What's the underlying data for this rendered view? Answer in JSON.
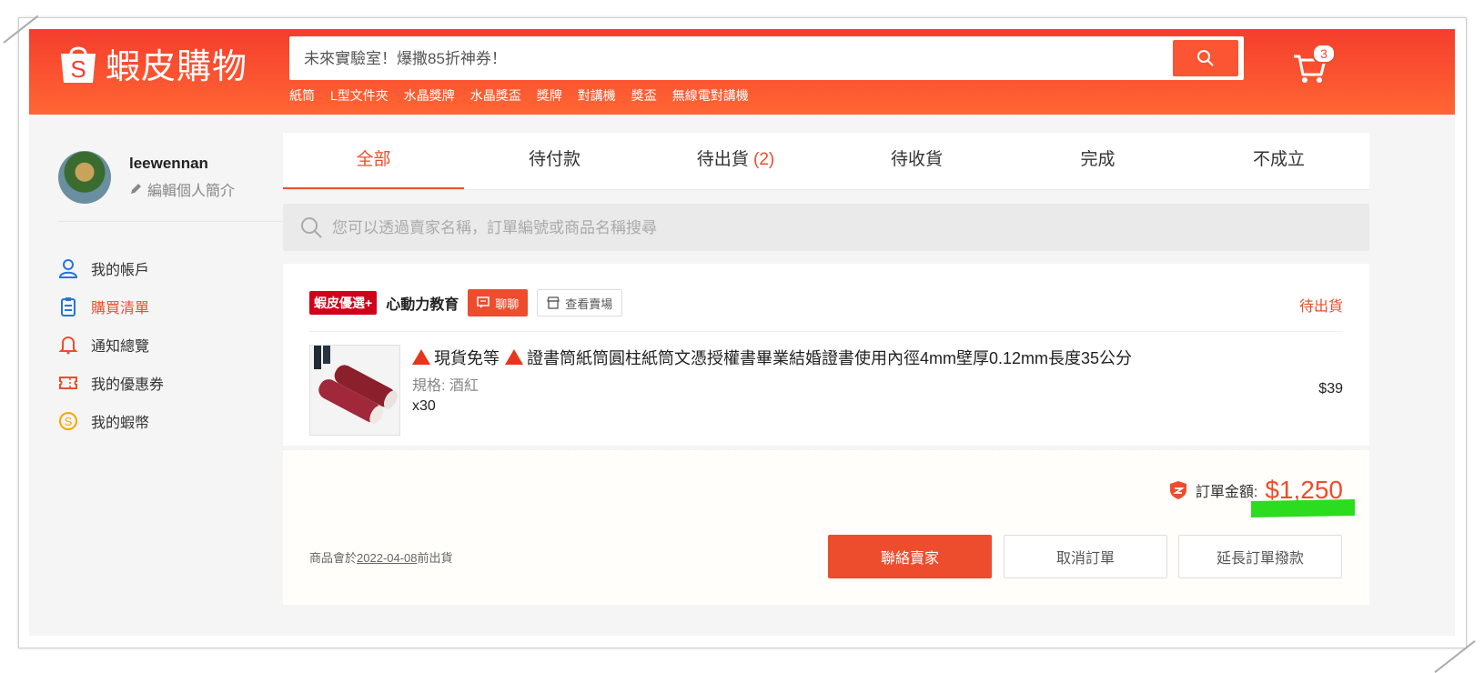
{
  "header": {
    "brand": "蝦皮購物",
    "search_placeholder": "未來實驗室！爆撒85折神券！",
    "hot_words": [
      "紙筒",
      "L型文件夾",
      "水晶獎牌",
      "水晶獎盃",
      "獎牌",
      "對講機",
      "獎盃",
      "無線電對講機"
    ],
    "cart_count": "3",
    "colors": {
      "brand": "#ee4d2d"
    }
  },
  "sidebar": {
    "username": "leewennan",
    "edit_profile": "編輯個人簡介",
    "menu": [
      {
        "label": "我的帳戶",
        "icon": "user-icon",
        "active": false
      },
      {
        "label": "購買清單",
        "icon": "clipboard-icon",
        "active": true
      },
      {
        "label": "通知總覽",
        "icon": "bell-icon",
        "active": false
      },
      {
        "label": "我的優惠券",
        "icon": "ticket-icon",
        "active": false
      },
      {
        "label": "我的蝦幣",
        "icon": "coin-icon",
        "active": false
      }
    ]
  },
  "tabs": [
    {
      "label": "全部",
      "count": "",
      "active": true
    },
    {
      "label": "待付款",
      "count": "",
      "active": false
    },
    {
      "label": "待出貨",
      "count": "(2)",
      "active": false
    },
    {
      "label": "待收貨",
      "count": "",
      "active": false
    },
    {
      "label": "完成",
      "count": "",
      "active": false
    },
    {
      "label": "不成立",
      "count": "",
      "active": false
    }
  ],
  "order_search": {
    "placeholder": "您可以透過賣家名稱，訂單編號或商品名稱搜尋"
  },
  "order": {
    "mall_badge": "蝦皮優選+",
    "shop_name": "心動力教育",
    "chat_label": "聊聊",
    "view_shop_label": "查看賣場",
    "status": "待出貨",
    "product_title": "現貨免等",
    "product_title_rest": "證書筒紙筒圓柱紙筒文憑授權書畢業結婚證書使用內徑4mm壁厚0.12mm長度35公分",
    "variant": "規格: 酒紅",
    "quantity": "x30",
    "price": "$39",
    "total_label": "訂單金額:",
    "total_value": "$1,250",
    "ship_note_prefix": "商品會於",
    "ship_date": "2022-04-08",
    "ship_note_suffix": "前出貨",
    "contact_seller": "聯絡賣家",
    "cancel_order": "取消訂單",
    "extend_payment": "延長訂單撥款"
  }
}
